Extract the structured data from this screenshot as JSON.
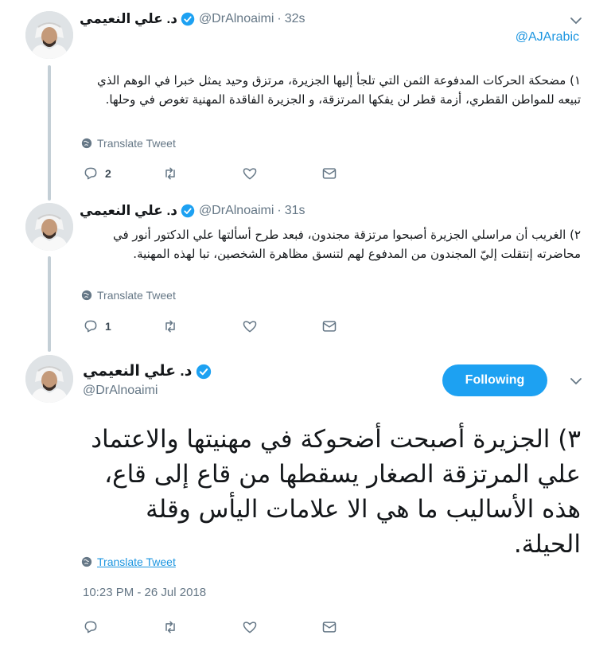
{
  "tweets": [
    {
      "author_name": "د. علي النعيمي",
      "handle": "@DrAlnoaimi",
      "separator": "·",
      "time": "32s",
      "reply_to": "@AJArabic",
      "text": "١) مضحكة الحركات المدفوعة الثمن التي تلجأ إليها الجزيرة، مرتزق وحيد يمثل خبرا في الوهم الذي تبيعه للمواطن القطري، أزمة قطر لن يفكها المرتزقة، و الجزيرة الفاقدة المهنية تغوص في وحلها.",
      "translate_label": "Translate Tweet",
      "reply_count": "2"
    },
    {
      "author_name": "د. علي النعيمي",
      "handle": "@DrAlnoaimi",
      "separator": "·",
      "time": "31s",
      "text": "٢) الغريب أن مراسلي الجزيرة أصبحوا مرتزقة مجندون، فبعد طرح أسألتها علي الدكتور أنور في محاضرته إنتقلت إليّ المجندون من المدفوع لهم لتنسق مظاهرة الشخصين، تبا لهذه المهنية.",
      "translate_label": "Translate Tweet",
      "reply_count": "1"
    }
  ],
  "main_tweet": {
    "author_name": "د. علي النعيمي",
    "handle": "@DrAlnoaimi",
    "follow_label": "Following",
    "text": "٣) الجزيرة أصبحت أضحوكة في مهنيتها والاعتماد علي المرتزقة الصغار يسقطها من قاع إلى قاع، هذه الأساليب ما هي الا علامات اليأس وقلة الحيلة.",
    "translate_label": "Translate Tweet",
    "timestamp": "10:23 PM - 26 Jul 2018"
  },
  "icons": {
    "verified": "verified-badge-icon",
    "chevron": "chevron-down-icon",
    "globe": "globe-icon",
    "reply": "reply-icon",
    "retweet": "retweet-icon",
    "like": "like-icon",
    "dm": "direct-message-icon"
  },
  "colors": {
    "accent": "#1da1f2",
    "link": "#1b95e0",
    "muted": "#657786",
    "thread_line": "#c4cfd6"
  }
}
